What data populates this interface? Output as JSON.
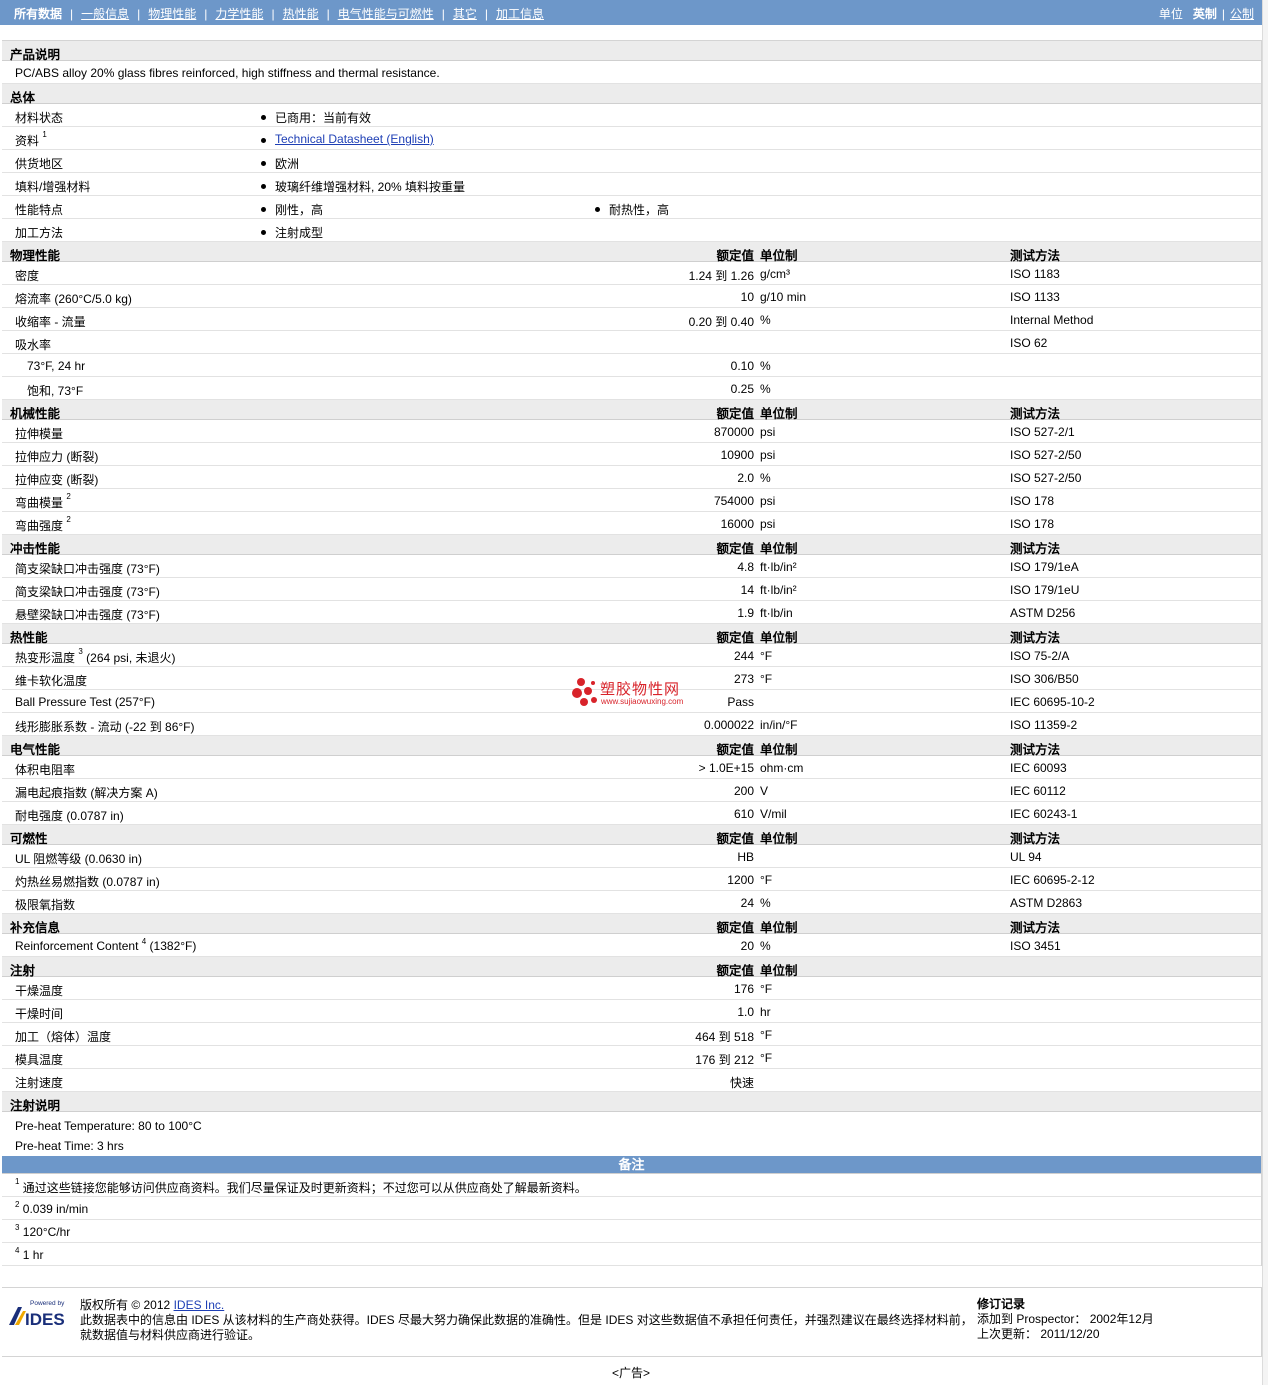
{
  "nav": {
    "all": "所有数据",
    "links": [
      "一般信息",
      "物理性能",
      "力学性能",
      "热性能",
      "电气性能与可燃性",
      "其它",
      "加工信息"
    ],
    "unit_label": "单位",
    "imperial": "英制",
    "metric": "公制"
  },
  "desc": {
    "title": "产品说明",
    "text": "PC/ABS alloy 20% glass fibres reinforced, high stiffness and thermal resistance."
  },
  "general": {
    "title": "总体",
    "rows": [
      {
        "label": "材料状态",
        "sup": "",
        "values": [
          "已商用：当前有效"
        ]
      },
      {
        "label": "资料",
        "sup": "1",
        "values": [
          "Technical Datasheet (English)"
        ]
      },
      {
        "label": "供货地区",
        "sup": "",
        "values": [
          "欧洲"
        ]
      },
      {
        "label": "填料/增强材料",
        "sup": "",
        "values": [
          "玻璃纤维增强材料, 20% 填料按重量"
        ]
      },
      {
        "label": "性能特点",
        "sup": "",
        "values": [
          "刚性，高",
          "耐热性，高"
        ]
      },
      {
        "label": "加工方法",
        "sup": "",
        "values": [
          "注射成型"
        ]
      }
    ]
  },
  "headers": {
    "value": "额定值",
    "unit": "单位制",
    "method": "测试方法"
  },
  "sections": [
    {
      "title": "物理性能",
      "method_col": true,
      "rows": [
        {
          "name": "密度",
          "sup": "",
          "cond": "",
          "val": "1.24 到  1.26",
          "unit": "g/cm³",
          "method": "ISO 1183",
          "sub": false
        },
        {
          "name": "熔流率",
          "sup": "",
          "cond": "(260°C/5.0 kg)",
          "val": "10",
          "unit": "g/10 min",
          "method": "ISO 1133",
          "sub": false
        },
        {
          "name": "收缩率 - 流量",
          "sup": "",
          "cond": "",
          "val": "0.20 到  0.40",
          "unit": "%",
          "method": "Internal Method",
          "sub": false
        },
        {
          "name": "吸水率",
          "sup": "",
          "cond": "",
          "val": "",
          "unit": "",
          "method": "ISO 62",
          "sub": false
        },
        {
          "name": "73°F, 24 hr",
          "sup": "",
          "cond": "",
          "val": "0.10",
          "unit": "%",
          "method": "",
          "sub": true
        },
        {
          "name": "饱和, 73°F",
          "sup": "",
          "cond": "",
          "val": "0.25",
          "unit": "%",
          "method": "",
          "sub": true
        }
      ]
    },
    {
      "title": "机械性能",
      "method_col": true,
      "rows": [
        {
          "name": "拉伸模量",
          "sup": "",
          "cond": "",
          "val": "870000",
          "unit": "psi",
          "method": "ISO 527-2/1",
          "sub": false
        },
        {
          "name": "拉伸应力",
          "sup": "",
          "cond": "(断裂)",
          "val": "10900",
          "unit": "psi",
          "method": "ISO 527-2/50",
          "sub": false
        },
        {
          "name": "拉伸应变",
          "sup": "",
          "cond": "(断裂)",
          "val": "2.0",
          "unit": "%",
          "method": "ISO 527-2/50",
          "sub": false
        },
        {
          "name": "弯曲模量",
          "sup": "2",
          "cond": "",
          "val": "754000",
          "unit": "psi",
          "method": "ISO 178",
          "sub": false
        },
        {
          "name": "弯曲强度",
          "sup": "2",
          "cond": "",
          "val": "16000",
          "unit": "psi",
          "method": "ISO 178",
          "sub": false
        }
      ]
    },
    {
      "title": "冲击性能",
      "method_col": true,
      "rows": [
        {
          "name": "简支梁缺口冲击强度",
          "sup": "",
          "cond": "(73°F)",
          "val": "4.8",
          "unit": "ft·lb/in²",
          "method": "ISO 179/1eA",
          "sub": false
        },
        {
          "name": "简支梁缺口冲击强度",
          "sup": "",
          "cond": "(73°F)",
          "val": "14",
          "unit": "ft·lb/in²",
          "method": "ISO 179/1eU",
          "sub": false
        },
        {
          "name": "悬壁梁缺口冲击强度",
          "sup": "",
          "cond": "(73°F)",
          "val": "1.9",
          "unit": "ft·lb/in",
          "method": "ASTM D256",
          "sub": false
        }
      ]
    },
    {
      "title": "热性能",
      "method_col": true,
      "rows": [
        {
          "name": "热变形温度",
          "sup": "3",
          "cond": "(264 psi, 未退火)",
          "val": "244",
          "unit": "°F",
          "method": "ISO 75-2/A",
          "sub": false
        },
        {
          "name": "维卡软化温度",
          "sup": "",
          "cond": "",
          "val": "273",
          "unit": "°F",
          "method": "ISO 306/B50",
          "sub": false
        },
        {
          "name": "Ball Pressure Test",
          "sup": "",
          "cond": "(257°F)",
          "val": "Pass",
          "unit": "",
          "method": "IEC 60695-10-2",
          "sub": false
        },
        {
          "name": "线形膨胀系数 - 流动",
          "sup": "",
          "cond": "(-22 到  86°F)",
          "val": "0.000022",
          "unit": "in/in/°F",
          "method": "ISO 11359-2",
          "sub": false
        }
      ]
    },
    {
      "title": "电气性能",
      "method_col": true,
      "rows": [
        {
          "name": "体积电阻率",
          "sup": "",
          "cond": "",
          "val": "> 1.0E+15",
          "unit": "ohm·cm",
          "method": "IEC 60093",
          "sub": false
        },
        {
          "name": "漏电起痕指数",
          "sup": "",
          "cond": "(解决方案  A)",
          "val": "200",
          "unit": "V",
          "method": "IEC 60112",
          "sub": false
        },
        {
          "name": "耐电强度",
          "sup": "",
          "cond": "(0.0787 in)",
          "val": "610",
          "unit": "V/mil",
          "method": "IEC 60243-1",
          "sub": false
        }
      ]
    },
    {
      "title": "可燃性",
      "method_col": true,
      "rows": [
        {
          "name": "UL 阻燃等级",
          "sup": "",
          "cond": "(0.0630 in)",
          "val": "HB",
          "unit": "",
          "method": "UL 94",
          "sub": false
        },
        {
          "name": "灼热丝易燃指数",
          "sup": "",
          "cond": "(0.0787 in)",
          "val": "1200",
          "unit": "°F",
          "method": "IEC 60695-2-12",
          "sub": false
        },
        {
          "name": "极限氧指数",
          "sup": "",
          "cond": "",
          "val": "24",
          "unit": "%",
          "method": "ASTM D2863",
          "sub": false
        }
      ]
    },
    {
      "title": "补充信息",
      "method_col": true,
      "rows": [
        {
          "name": "Reinforcement Content",
          "sup": "4",
          "cond": "(1382°F)",
          "val": "20",
          "unit": "%",
          "method": "ISO 3451",
          "sub": false
        }
      ]
    },
    {
      "title": "注射",
      "method_col": false,
      "rows": [
        {
          "name": "干燥温度",
          "sup": "",
          "cond": "",
          "val": "176",
          "unit": "°F",
          "method": "",
          "sub": false
        },
        {
          "name": "干燥时间",
          "sup": "",
          "cond": "",
          "val": "1.0",
          "unit": "hr",
          "method": "",
          "sub": false
        },
        {
          "name": "加工（熔体）温度",
          "sup": "",
          "cond": "",
          "val": "464 到  518",
          "unit": "°F",
          "method": "",
          "sub": false
        },
        {
          "name": "模具温度",
          "sup": "",
          "cond": "",
          "val": "176 到  212",
          "unit": "°F",
          "method": "",
          "sub": false
        },
        {
          "name": "注射速度",
          "sup": "",
          "cond": "",
          "val": "快速",
          "unit": "",
          "method": "",
          "sub": false
        }
      ]
    }
  ],
  "injection_notes": {
    "title": "注射说明",
    "lines": [
      "Pre-heat Temperature: 80 to 100°C",
      "Pre-heat Time: 3 hrs"
    ]
  },
  "notes": {
    "title": "备注",
    "items": [
      {
        "num": "1",
        "text": "通过这些链接您能够访问供应商资料。我们尽量保证及时更新资料；不过您可以从供应商处了解最新资料。"
      },
      {
        "num": "2",
        "text": "0.039 in/min"
      },
      {
        "num": "3",
        "text": "120°C/hr"
      },
      {
        "num": "4",
        "text": "1 hr"
      }
    ]
  },
  "footer": {
    "logo_small": "Powered by",
    "logo_big": "IDES",
    "copyright_prefix": "版权所有  © 2012",
    "company_link": "IDES Inc.",
    "disclaimer1": "此数据表中的信息由  IDES 从该材料的生产商处获得。IDES 尽最大努力确保此数据的准确性。但是  IDES 对这些数据值不承担任何责任，并强烈建议在最终选择材料前，",
    "disclaimer2": "就数据值与材料供应商进行验证。",
    "rev_title": "修订记录",
    "rev_added": "添加到  Prospector：   2002年12月",
    "rev_updated": "上次更新：   2011/12/20"
  },
  "watermark": {
    "cn": "塑胶物性网",
    "url": "www.sujiaowuxing.com"
  },
  "ad": "<广告>",
  "colors": {
    "bar": "#6d97c9",
    "section": "#ececec",
    "link": "#1e3fb5",
    "watermark": "#d8232a"
  }
}
